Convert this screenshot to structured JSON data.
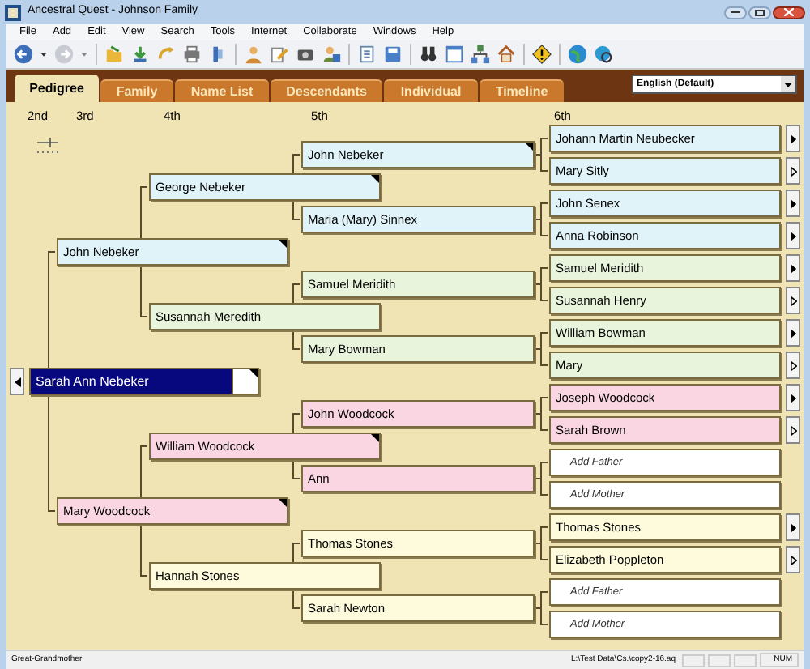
{
  "window": {
    "title": "Ancestral Quest - Johnson Family"
  },
  "menu": [
    "File",
    "Add",
    "Edit",
    "View",
    "Search",
    "Tools",
    "Internet",
    "Collaborate",
    "Windows",
    "Help"
  ],
  "tabs": [
    {
      "label": "Pedigree",
      "selected": true
    },
    {
      "label": "Family",
      "selected": false
    },
    {
      "label": "Name List",
      "selected": false
    },
    {
      "label": "Descendants",
      "selected": false
    },
    {
      "label": "Individual",
      "selected": false
    },
    {
      "label": "Timeline",
      "selected": false
    }
  ],
  "language_select": {
    "value": "English (Default)"
  },
  "generations": [
    "2nd",
    "3rd",
    "4th",
    "5th",
    "6th"
  ],
  "pedigree": {
    "name": "Sarah Ann Nebeker",
    "kind": "person",
    "selected": true,
    "corner_mark": true,
    "parents": [
      {
        "name": "John Nebeker",
        "kind": "person",
        "color": "#dff3f9",
        "selected": false,
        "corner_mark": true,
        "parents": [
          {
            "name": "George Nebeker",
            "kind": "person",
            "color": "#dff3f9",
            "selected": false,
            "corner_mark": true,
            "parents": [
              {
                "name": "John Nebeker",
                "kind": "person",
                "color": "#dff3f9",
                "selected": false,
                "corner_mark": true,
                "parents": [
                  {
                    "name": "Johann Martin Neubecker",
                    "kind": "person",
                    "color": "#dff3f9",
                    "selected": false,
                    "more_ancestors": true
                  },
                  {
                    "name": "Mary Sitly",
                    "kind": "person",
                    "color": "#dff3f9",
                    "selected": false,
                    "more_ancestors": false
                  }
                ]
              },
              {
                "name": "Maria (Mary) Sinnex",
                "kind": "person",
                "color": "#dff3f9",
                "selected": false,
                "corner_mark": false,
                "parents": [
                  {
                    "name": "John Senex",
                    "kind": "person",
                    "color": "#dff3f9",
                    "selected": false,
                    "more_ancestors": true
                  },
                  {
                    "name": "Anna Robinson",
                    "kind": "person",
                    "color": "#dff3f9",
                    "selected": false,
                    "more_ancestors": true
                  }
                ]
              }
            ]
          },
          {
            "name": "Susannah Meredith",
            "kind": "person",
            "color": "#e8f5dc",
            "selected": false,
            "corner_mark": false,
            "parents": [
              {
                "name": "Samuel Meridith",
                "kind": "person",
                "color": "#e8f5dc",
                "selected": false,
                "corner_mark": false,
                "parents": [
                  {
                    "name": "Samuel Meridith",
                    "kind": "person",
                    "color": "#e8f5dc",
                    "selected": false,
                    "more_ancestors": true
                  },
                  {
                    "name": "Susannah Henry",
                    "kind": "person",
                    "color": "#e8f5dc",
                    "selected": false,
                    "more_ancestors": false
                  }
                ]
              },
              {
                "name": "Mary Bowman",
                "kind": "person",
                "color": "#e8f5dc",
                "selected": false,
                "corner_mark": false,
                "parents": [
                  {
                    "name": "William Bowman",
                    "kind": "person",
                    "color": "#e8f5dc",
                    "selected": false,
                    "more_ancestors": true
                  },
                  {
                    "name": "Mary",
                    "kind": "person",
                    "color": "#e8f5dc",
                    "selected": false,
                    "more_ancestors": false
                  }
                ]
              }
            ]
          }
        ]
      },
      {
        "name": "Mary Woodcock",
        "kind": "person",
        "color": "#fad6e2",
        "selected": false,
        "corner_mark": true,
        "parents": [
          {
            "name": "William Woodcock",
            "kind": "person",
            "color": "#fad6e2",
            "selected": false,
            "corner_mark": true,
            "parents": [
              {
                "name": "John Woodcock",
                "kind": "person",
                "color": "#fad6e2",
                "selected": false,
                "corner_mark": false,
                "parents": [
                  {
                    "name": "Joseph Woodcock",
                    "kind": "person",
                    "color": "#fad6e2",
                    "selected": false,
                    "more_ancestors": true
                  },
                  {
                    "name": "Sarah Brown",
                    "kind": "person",
                    "color": "#fad6e2",
                    "selected": false,
                    "more_ancestors": false
                  }
                ]
              },
              {
                "name": "Ann",
                "kind": "person",
                "color": "#fad6e2",
                "selected": false,
                "corner_mark": false,
                "parents": [
                  {
                    "name": "Add Father",
                    "kind": "add"
                  },
                  {
                    "name": "Add Mother",
                    "kind": "add"
                  }
                ]
              }
            ]
          },
          {
            "name": "Hannah Stones",
            "kind": "person",
            "color": "#fdfbdb",
            "selected": false,
            "corner_mark": false,
            "parents": [
              {
                "name": "Thomas Stones",
                "kind": "person",
                "color": "#fdfbdb",
                "selected": false,
                "corner_mark": false,
                "parents": [
                  {
                    "name": "Thomas Stones",
                    "kind": "person",
                    "color": "#fdfbdb",
                    "selected": false,
                    "more_ancestors": true
                  },
                  {
                    "name": "Elizabeth Poppleton",
                    "kind": "person",
                    "color": "#fdfbdb",
                    "selected": false,
                    "more_ancestors": false
                  }
                ]
              },
              {
                "name": "Sarah Newton",
                "kind": "person",
                "color": "#fdfbdb",
                "selected": false,
                "corner_mark": false,
                "parents": [
                  {
                    "name": "Add Father",
                    "kind": "add"
                  },
                  {
                    "name": "Add Mother",
                    "kind": "add"
                  }
                ]
              }
            ]
          }
        ]
      }
    ]
  },
  "status_bar": {
    "relationship": "Great-Grandmother",
    "file": "L:\\Test Data\\Cs.\\copy2-16.aq",
    "indicator": "NUM"
  }
}
